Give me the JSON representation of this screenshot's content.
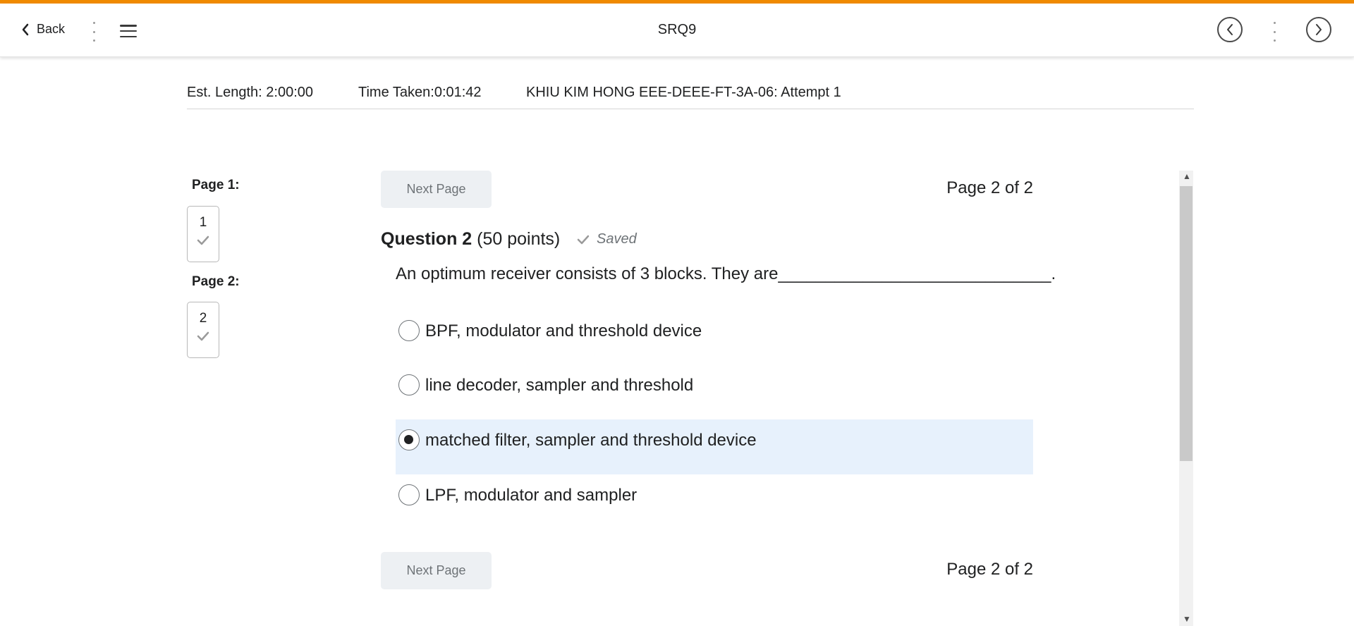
{
  "header": {
    "back_label": "Back",
    "title": "SRQ9",
    "accent_color": "#f08a00"
  },
  "info": {
    "est_length": "Est. Length: 2:00:00",
    "time_taken": "Time Taken:0:01:42",
    "attempt": "KHIU KIM HONG EEE-DEEE-FT-3A-06: Attempt 1"
  },
  "sidebar": {
    "pages": [
      {
        "label": "Page 1:",
        "number": "1",
        "answered": true
      },
      {
        "label": "Page 2:",
        "number": "2",
        "answered": true
      }
    ]
  },
  "nav": {
    "next_page_label": "Next Page",
    "page_indicator": "Page 2 of 2"
  },
  "question": {
    "title": "Question 2",
    "points": "(50 points)",
    "status": "Saved",
    "text": "An optimum receiver consists of 3 blocks. They are_____________________________.",
    "options": [
      {
        "label": "BPF, modulator and threshold device",
        "selected": false
      },
      {
        "label": " line decoder, sampler and threshold",
        "selected": false
      },
      {
        "label": "matched filter, sampler and threshold device",
        "selected": true
      },
      {
        "label": " LPF, modulator and sampler",
        "selected": false
      }
    ],
    "selected_color": "#e7f1fc"
  }
}
